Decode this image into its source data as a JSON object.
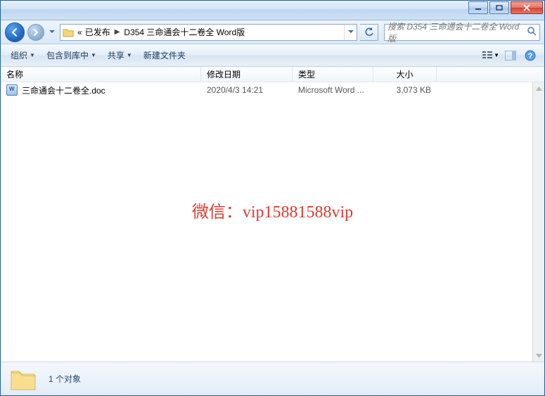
{
  "titlebar": {},
  "nav": {
    "crumb_prefix": "«",
    "crumb1": "已发布",
    "crumb2": "D354 三命通会十二卷全 Word版",
    "search_placeholder": "搜索 D354 三命通会十二卷全 Word版"
  },
  "toolbar": {
    "organize": "组织",
    "include": "包含到库中",
    "share": "共享",
    "new_folder": "新建文件夹"
  },
  "columns": {
    "name": "名称",
    "date": "修改日期",
    "type": "类型",
    "size": "大小"
  },
  "files": [
    {
      "name": "三命通会十二卷全.doc",
      "date": "2020/4/3 14:21",
      "type": "Microsoft Word ...",
      "size": "3,073 KB"
    }
  ],
  "watermark": "微信：vip15881588vip",
  "status": {
    "count_label": "1 个对象"
  }
}
